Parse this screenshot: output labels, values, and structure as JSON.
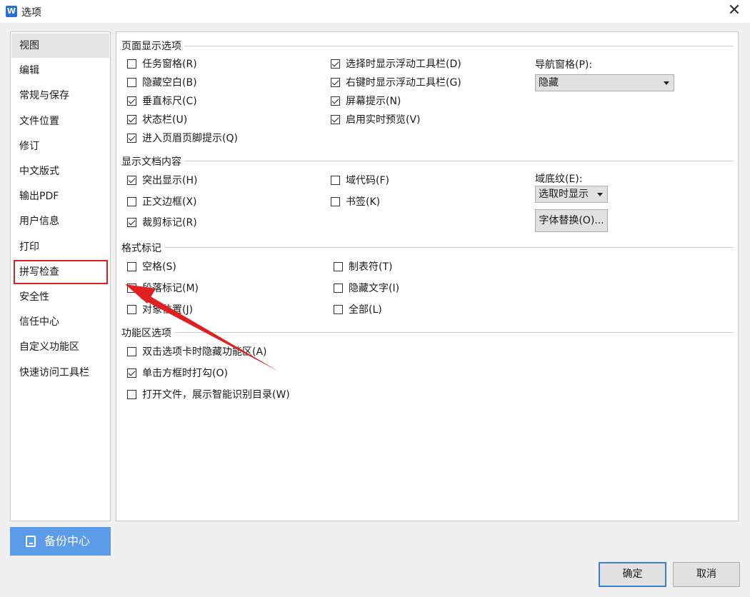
{
  "window": {
    "title": "选项",
    "app_icon_glyph": "W",
    "close_glyph": "✕"
  },
  "sidebar": {
    "items": [
      {
        "label": "视图"
      },
      {
        "label": "编辑"
      },
      {
        "label": "常规与保存"
      },
      {
        "label": "文件位置"
      },
      {
        "label": "修订"
      },
      {
        "label": "中文版式"
      },
      {
        "label": "输出PDF"
      },
      {
        "label": "用户信息"
      },
      {
        "label": "打印"
      },
      {
        "label": "拼写检查"
      },
      {
        "label": "安全性"
      },
      {
        "label": "信任中心"
      },
      {
        "label": "自定义功能区"
      },
      {
        "label": "快速访问工具栏"
      }
    ],
    "active_index": 0,
    "highlighted_index": 9
  },
  "sections": {
    "page_display": {
      "title": "页面显示选项",
      "left": [
        {
          "label": "任务窗格(R)",
          "checked": false
        },
        {
          "label": "隐藏空白(B)",
          "checked": false
        },
        {
          "label": "垂直标尺(C)",
          "checked": true
        },
        {
          "label": "状态栏(U)",
          "checked": true
        },
        {
          "label": "进入页眉页脚提示(Q)",
          "checked": true
        }
      ],
      "right": [
        {
          "label": "选择时显示浮动工具栏(D)",
          "checked": true
        },
        {
          "label": "右键时显示浮动工具栏(G)",
          "checked": true
        },
        {
          "label": "屏幕提示(N)",
          "checked": true
        },
        {
          "label": "启用实时预览(V)",
          "checked": true
        }
      ],
      "nav_label": "导航窗格(P):",
      "nav_value": "隐藏"
    },
    "doc_content": {
      "title": "显示文档内容",
      "left": [
        {
          "label": "突出显示(H)",
          "checked": true
        },
        {
          "label": "正文边框(X)",
          "checked": false
        },
        {
          "label": "裁剪标记(R)",
          "checked": true
        }
      ],
      "right": [
        {
          "label": "域代码(F)",
          "checked": false
        },
        {
          "label": "书签(K)",
          "checked": false
        }
      ],
      "shading_label": "域底纹(E):",
      "shading_value": "选取时显示",
      "font_sub_button": "字体替换(O)..."
    },
    "format_marks": {
      "title": "格式标记",
      "left": [
        {
          "label": "空格(S)",
          "checked": false
        },
        {
          "label": "段落标记(M)",
          "checked": false
        },
        {
          "label": "对象位置(J)",
          "checked": false
        }
      ],
      "right": [
        {
          "label": "制表符(T)",
          "checked": false
        },
        {
          "label": "隐藏文字(I)",
          "checked": false
        },
        {
          "label": "全部(L)",
          "checked": false
        }
      ]
    },
    "ribbon": {
      "title": "功能区选项",
      "items": [
        {
          "label": "双击选项卡时隐藏功能区(A)",
          "checked": false
        },
        {
          "label": "单击方框时打勾(O)",
          "checked": true
        },
        {
          "label": "打开文件，展示智能识别目录(W)",
          "checked": false
        }
      ]
    }
  },
  "backup_button": {
    "label": "备份中心"
  },
  "footer": {
    "ok": "确定",
    "cancel": "取消"
  },
  "colors": {
    "accent": "#3c7fd1",
    "backup_bg": "#5b9be8",
    "annotation_red": "#e02020"
  }
}
